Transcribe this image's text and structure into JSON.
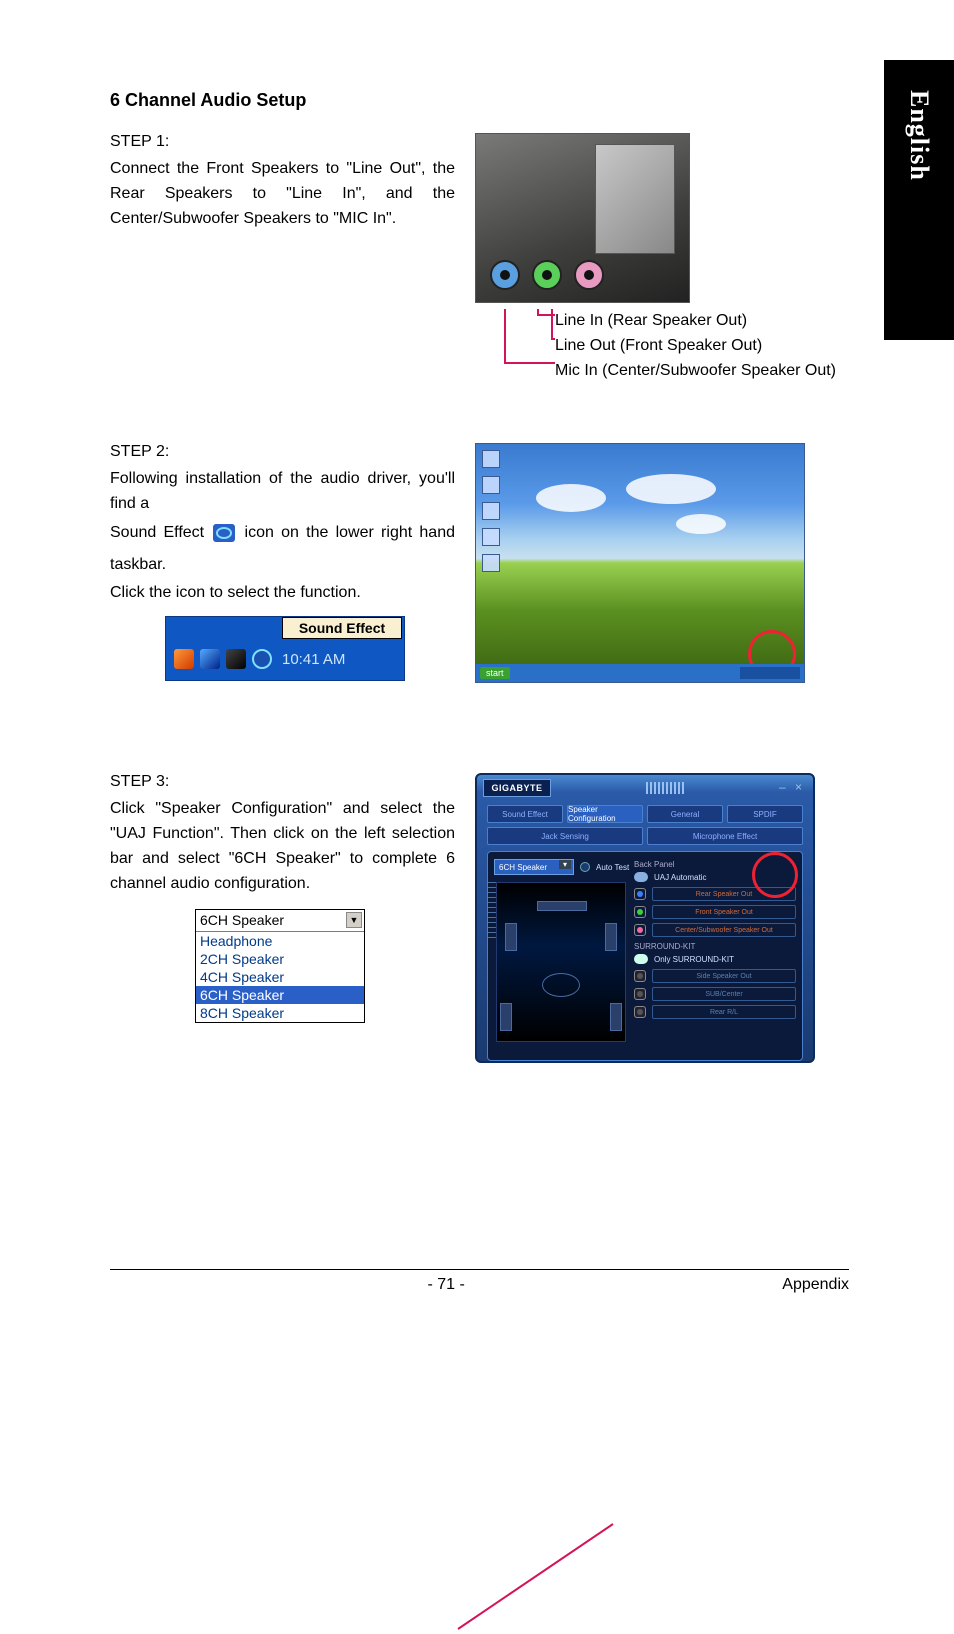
{
  "lang_tab": "English",
  "heading": "6 Channel Audio Setup",
  "step1": {
    "label": "STEP 1:",
    "text": "Connect the Front Speakers to \"Line Out\", the Rear Speakers to \"Line In\", and the Center/Subwoofer Speakers to \"MIC In\".",
    "legend": {
      "line_in": "Line In (Rear Speaker Out)",
      "line_out": "Line Out (Front Speaker Out)",
      "mic_in": "Mic In (Center/Subwoofer Speaker Out)"
    }
  },
  "step2": {
    "label": "STEP 2:",
    "text_a": "Following installation of the audio driver, you'll find a",
    "text_b_prefix": "Sound Effect ",
    "text_b_suffix": " icon on the lower right hand taskbar.",
    "text_c": "Click the icon to select the function.",
    "tooltip": "Sound Effect",
    "clock": "10:41 AM",
    "desktop": {
      "start": "start"
    }
  },
  "step3": {
    "label": "STEP 3:",
    "text": "Click \"Speaker Configuration\" and select the \"UAJ Function\".  Then click on the left selection bar and select \"6CH Speaker\" to complete 6 channel audio configuration.",
    "dropdown": {
      "selected": "6CH Speaker",
      "options": [
        "Headphone",
        "2CH Speaker",
        "4CH Speaker",
        "6CH Speaker",
        "8CH Speaker"
      ],
      "highlight_index": 3
    },
    "app": {
      "brand": "GIGABYTE",
      "tabs": [
        "Sound Effect",
        "Speaker Configuration",
        "General",
        "SPDIF",
        "Jack Sensing",
        "Microphone Effect"
      ],
      "active_tab_index": 1,
      "combo_value": "6CH Speaker",
      "auto_test": "Auto Test",
      "back_panel": "Back Panel",
      "uaj_auto": "UAJ Automatic",
      "jacks_back": [
        "Rear Speaker Out",
        "Front Speaker Out",
        "Center/Subwoofer Speaker Out"
      ],
      "surround_kit": "SURROUND-KIT",
      "only_surround": "Only SURROUND-KIT",
      "jacks_kit": [
        "Side Speaker Out",
        "SUB/Center",
        "Rear R/L"
      ]
    }
  },
  "footer": {
    "page": "- 71 -",
    "section": "Appendix"
  }
}
